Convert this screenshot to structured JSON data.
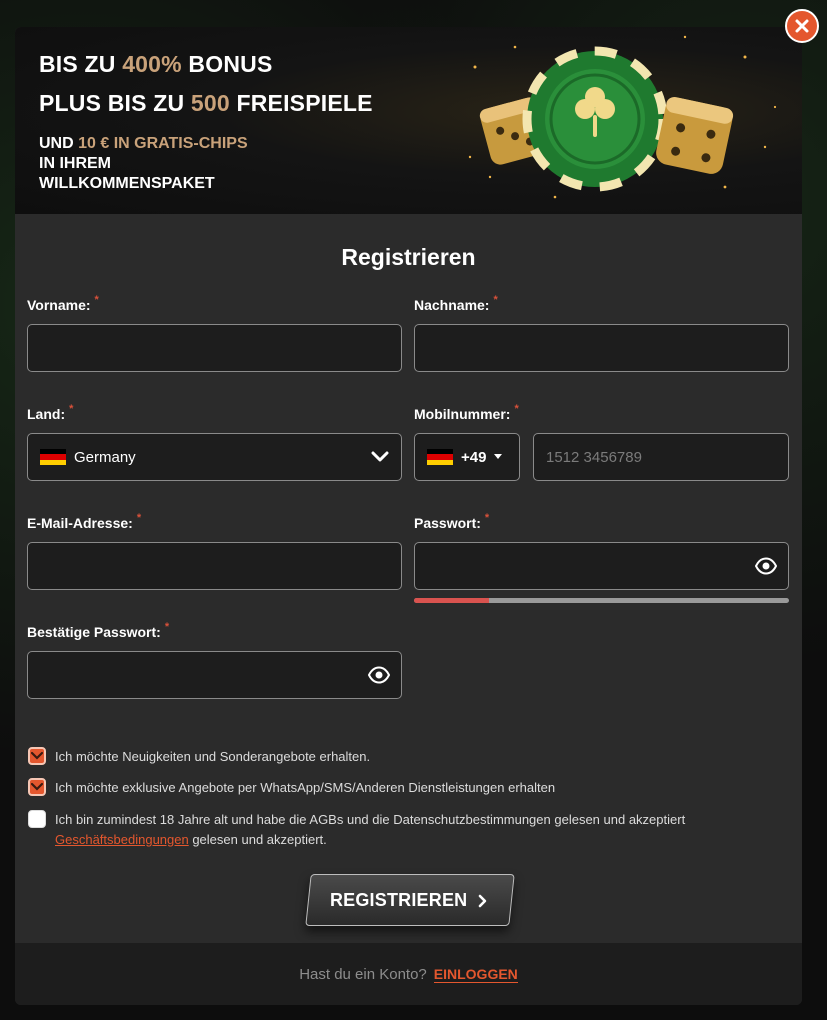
{
  "banner": {
    "line1_pre": "BIS ZU ",
    "line1_hl": "400%",
    "line1_post": " BONUS",
    "line2_pre": "PLUS BIS ZU ",
    "line2_hl": "500",
    "line2_post": " FREISPIELE",
    "sub_pre": "UND ",
    "sub_hl": "10 € IN GRATIS-CHIPS",
    "sub_line2": "IN IHREM",
    "sub_line3": "WILLKOMMENSPAKET"
  },
  "form": {
    "title": "Registrieren",
    "required_mark": "*",
    "first_name": {
      "label": "Vorname:",
      "value": ""
    },
    "last_name": {
      "label": "Nachname:",
      "value": ""
    },
    "country": {
      "label": "Land:",
      "value": "Germany"
    },
    "mobile": {
      "label": "Mobilnummer:",
      "dial_code": "+49",
      "placeholder": "1512 3456789"
    },
    "email": {
      "label": "E-Mail-Adresse:",
      "value": ""
    },
    "password": {
      "label": "Passwort:",
      "strength": 0.2
    },
    "confirm_password": {
      "label": "Bestätige Passwort:"
    }
  },
  "checkboxes": [
    {
      "label": "Ich möchte Neuigkeiten und Sonderangebote erhalten.",
      "checked": true
    },
    {
      "label": "Ich möchte exklusive Angebote per WhatsApp/SMS/Anderen Dienstleistungen erhalten",
      "checked": true
    },
    {
      "label": "Ich bin zumindest 18 Jahre alt und habe die AGBs und die Datenschutzbestimmungen gelesen und akzeptiert",
      "link": "Geschäftsbedingungen",
      "link_suffix": " gelesen und akzeptiert.",
      "checked": false
    }
  ],
  "submit_label": "REGISTRIEREN",
  "footer": {
    "text": "Hast du ein Konto?",
    "link": "EINLOGGEN"
  },
  "colors": {
    "accent": "#e4572e",
    "highlight": "#c9a27a",
    "strength_bar": "#d9534f"
  },
  "icons": {
    "close": "close-icon",
    "eye": "eye-icon",
    "chevron": "chevron-down-icon",
    "arrow": "chevron-right-icon",
    "flag": "germany-flag-icon"
  }
}
